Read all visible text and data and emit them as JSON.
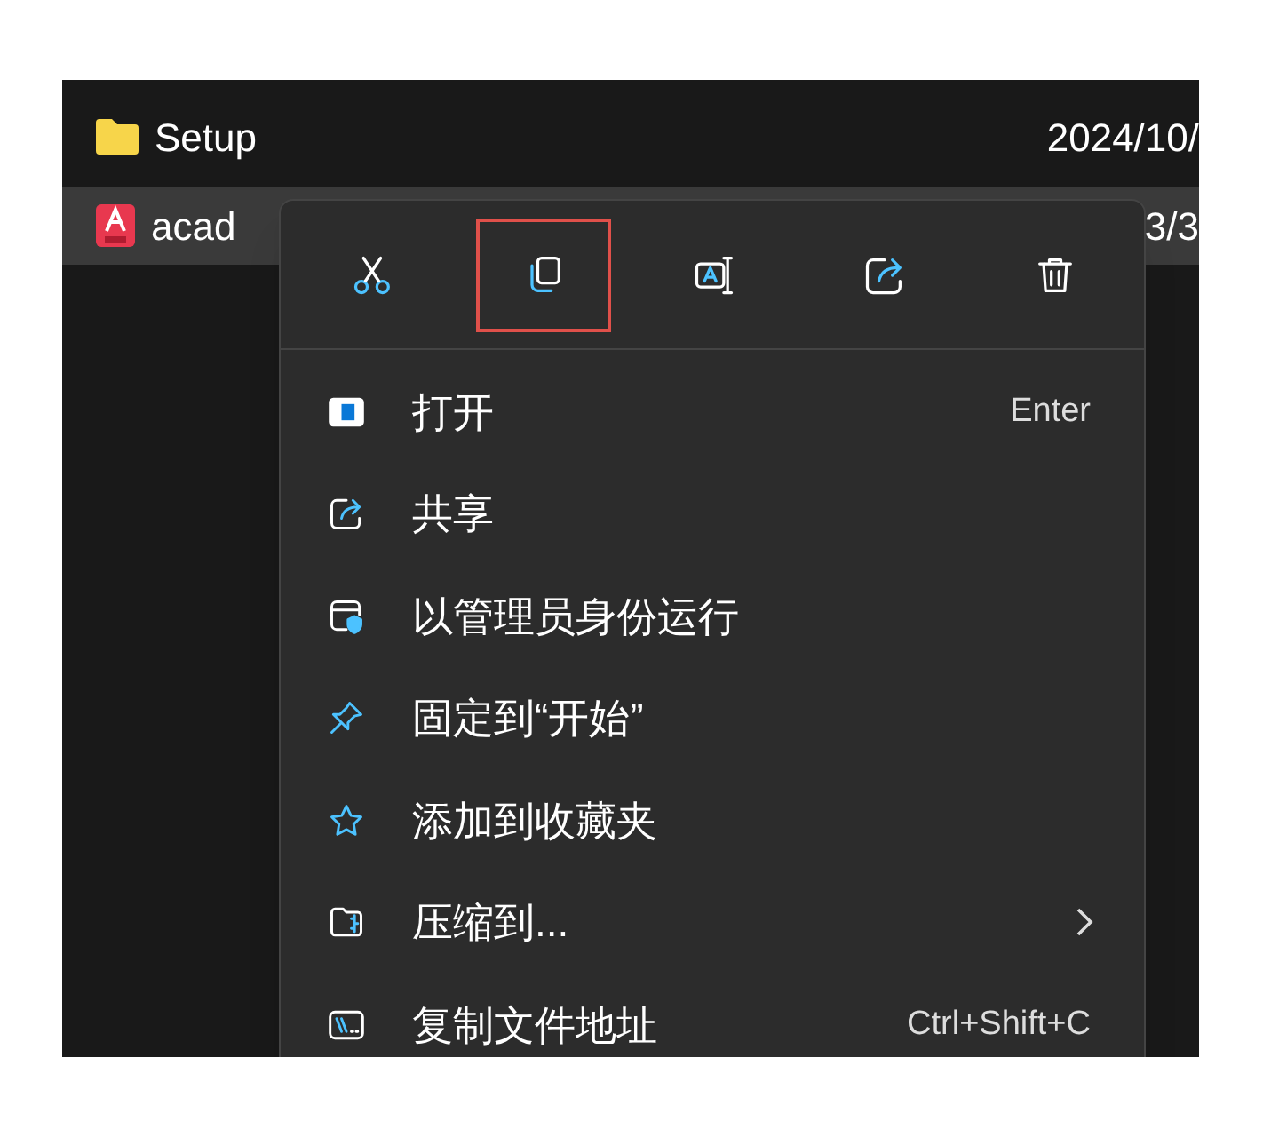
{
  "files": [
    {
      "name": "Setup",
      "kind": "folder",
      "date": "2024/10/",
      "selected": false
    },
    {
      "name": "acad",
      "kind": "app",
      "date": "3/3",
      "selected": true
    }
  ],
  "context_menu": {
    "toolbar": [
      {
        "kind": "cut",
        "highlighted": false
      },
      {
        "kind": "copy",
        "highlighted": true
      },
      {
        "kind": "rename",
        "highlighted": false
      },
      {
        "kind": "share",
        "highlighted": false
      },
      {
        "kind": "delete",
        "highlighted": false
      }
    ],
    "items": [
      {
        "kind": "open",
        "label": "打开",
        "shortcut": "Enter",
        "submenu": false
      },
      {
        "kind": "share",
        "label": "共享",
        "submenu": false
      },
      {
        "kind": "admin",
        "label": "以管理员身份运行",
        "submenu": false
      },
      {
        "kind": "pin",
        "label": "固定到“开始”",
        "submenu": false
      },
      {
        "kind": "favorite",
        "label": "添加到收藏夹",
        "submenu": false
      },
      {
        "kind": "compress",
        "label": "压缩到...",
        "submenu": true
      },
      {
        "kind": "copypath",
        "label": "复制文件地址",
        "shortcut": "Ctrl+Shift+C",
        "submenu": false
      }
    ]
  }
}
